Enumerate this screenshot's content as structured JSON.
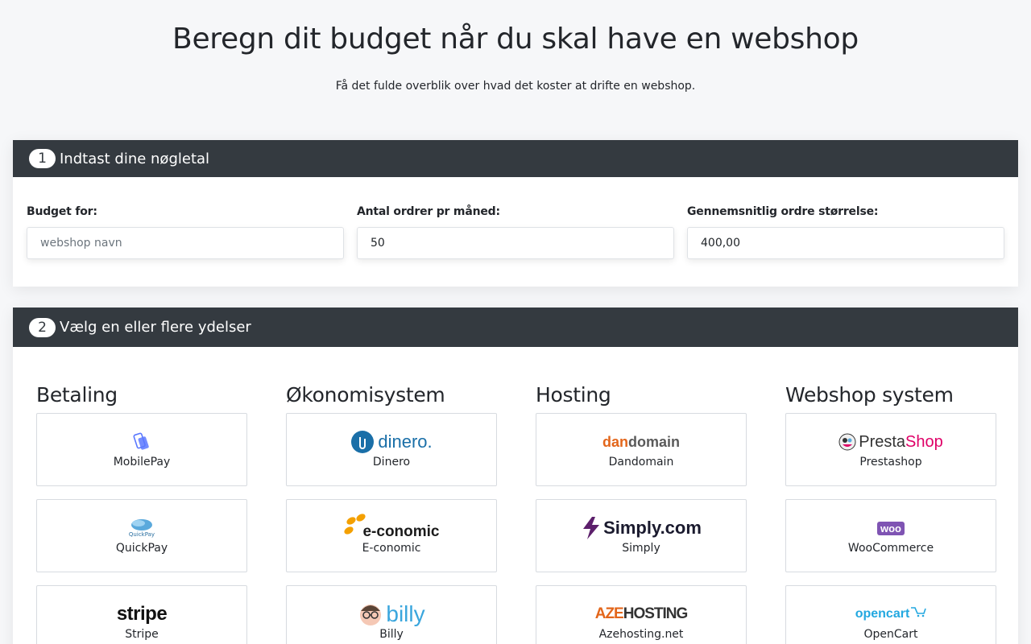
{
  "header": {
    "title": "Beregn dit budget når du skal have en webshop",
    "subtitle": "Få det fulde overblik over hvad det koster at drifte en webshop."
  },
  "step1": {
    "number": "1",
    "title": "Indtast dine nøgletal",
    "fields": [
      {
        "label": "Budget for:",
        "value": "",
        "placeholder": "webshop navn"
      },
      {
        "label": "Antal ordrer pr måned:",
        "value": "50",
        "placeholder": ""
      },
      {
        "label": "Gennemsnitlig ordre størrelse:",
        "value": "400,00",
        "placeholder": ""
      }
    ]
  },
  "step2": {
    "number": "2",
    "title": "Vælg en eller flere ydelser",
    "columns": [
      {
        "title": "Betaling",
        "items": [
          {
            "name": "MobilePay",
            "icon": "mobilepay-logo"
          },
          {
            "name": "QuickPay",
            "icon": "quickpay-logo",
            "logo_text": "QuickPay"
          },
          {
            "name": "Stripe",
            "icon": "stripe-logo",
            "logo_text": "stripe"
          }
        ]
      },
      {
        "title": "Økonomisystem",
        "items": [
          {
            "name": "Dinero",
            "icon": "dinero-logo",
            "logo_text": "dinero."
          },
          {
            "name": "E-conomic",
            "icon": "e-conomic-logo",
            "logo_text": "e-conomic"
          },
          {
            "name": "Billy",
            "icon": "billy-logo",
            "logo_text": "billy"
          }
        ]
      },
      {
        "title": "Hosting",
        "items": [
          {
            "name": "Dandomain",
            "icon": "dandomain-logo",
            "logo_text_a": "dan",
            "logo_text_b": "domain"
          },
          {
            "name": "Simply",
            "icon": "simply-logo",
            "logo_text": "Simply.com"
          },
          {
            "name": "Azehosting.net",
            "icon": "azehosting-logo",
            "logo_text_a": "AZE",
            "logo_text_b": "HOSTING"
          }
        ]
      },
      {
        "title": "Webshop system",
        "items": [
          {
            "name": "Prestashop",
            "icon": "prestashop-logo",
            "logo_text_a": "Presta",
            "logo_text_b": "Shop"
          },
          {
            "name": "WooCommerce",
            "icon": "woocommerce-logo",
            "logo_text": "woo"
          },
          {
            "name": "OpenCart",
            "icon": "opencart-logo",
            "logo_text": "opencart"
          }
        ]
      }
    ]
  },
  "colors": {
    "header_dark": "#343a40",
    "page_bg": "#f6f7f9",
    "mobilepay_blue": "#5a78ff",
    "dinero_blue": "#1a6fa8",
    "economic_orange": "#f4a000",
    "dandomain_orange": "#e3661b",
    "simply_purple": "#5c1f6b",
    "prestashop_pink": "#df0067",
    "woo_purple": "#7f54b3",
    "opencart_blue": "#23a8e0"
  }
}
